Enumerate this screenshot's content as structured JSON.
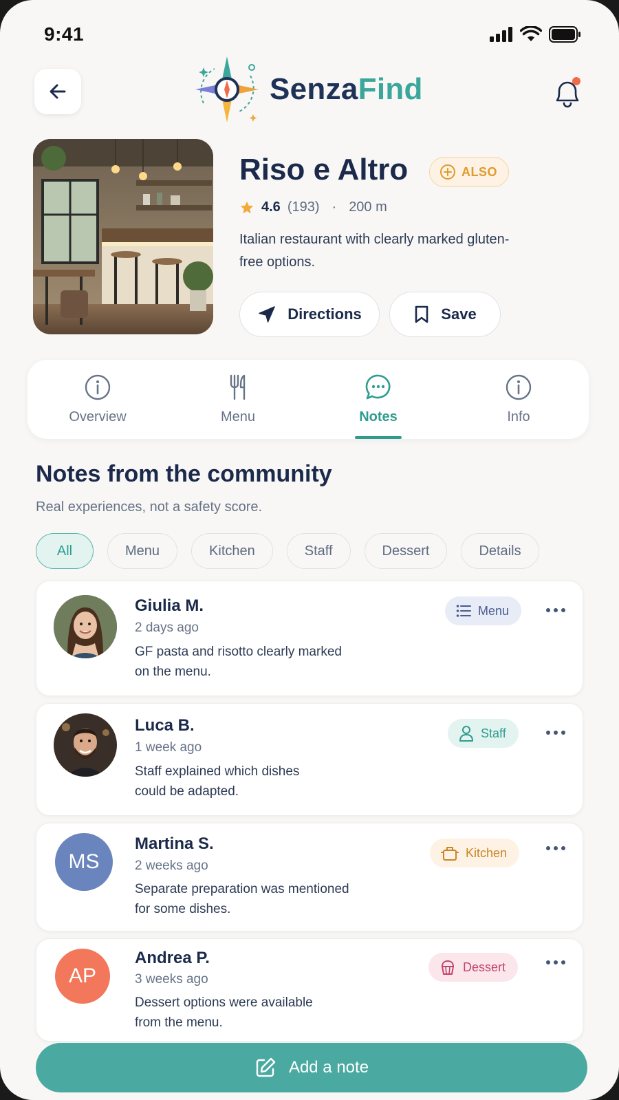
{
  "status_bar": {
    "time": "9:41"
  },
  "app": {
    "logo_part1": "Senza",
    "logo_part2": "Find"
  },
  "place": {
    "name": "Riso e Altro",
    "badge": "ALSO",
    "rating": "4.6",
    "reviews": "(193)",
    "separator": "·",
    "distance": "200 m",
    "description": "Italian restaurant with clearly marked gluten-free options."
  },
  "actions": {
    "directions": "Directions",
    "save": "Save"
  },
  "tabs": [
    {
      "label": "Overview",
      "icon": "info-icon"
    },
    {
      "label": "Menu",
      "icon": "fork-knife-icon"
    },
    {
      "label": "Notes",
      "icon": "chat-bubble-icon",
      "active": true
    },
    {
      "label": "Info",
      "icon": "info-icon"
    }
  ],
  "community": {
    "title": "Notes from the community",
    "subtitle": "Real experiences, not a safety score.",
    "filters": [
      "All",
      "Menu",
      "Kitchen",
      "Staff",
      "Dessert",
      "Details"
    ],
    "active_filter": "All"
  },
  "notes": [
    {
      "name": "Giulia M.",
      "time": "2 days ago",
      "text_line1": "GF pasta and risotto clearly marked",
      "text_line2": "on the menu.",
      "tag": "Menu",
      "tag_icon": "list-icon",
      "avatar": "photo"
    },
    {
      "name": "Luca B.",
      "time": "1 week ago",
      "text_line1": "Staff explained which dishes",
      "text_line2": "could be adapted.",
      "tag": "Staff",
      "tag_icon": "person-icon",
      "avatar": "photo"
    },
    {
      "name": "Martina S.",
      "time": "2 weeks ago",
      "text_line1": "Separate preparation was mentioned",
      "text_line2": "for some dishes.",
      "tag": "Kitchen",
      "tag_icon": "pot-icon",
      "avatar_initials": "MS"
    },
    {
      "name": "Andrea P.",
      "time": "3 weeks ago",
      "text_line1": "Dessert options were available",
      "text_line2": "from the menu.",
      "tag": "Dessert",
      "tag_icon": "cupcake-icon",
      "avatar_initials": "AP"
    }
  ],
  "add_note": "Add a note",
  "colors": {
    "accent": "#2f9c8f",
    "navy": "#1b2a4a",
    "also": "#e19a2c",
    "add_button": "#4aaaa1"
  }
}
